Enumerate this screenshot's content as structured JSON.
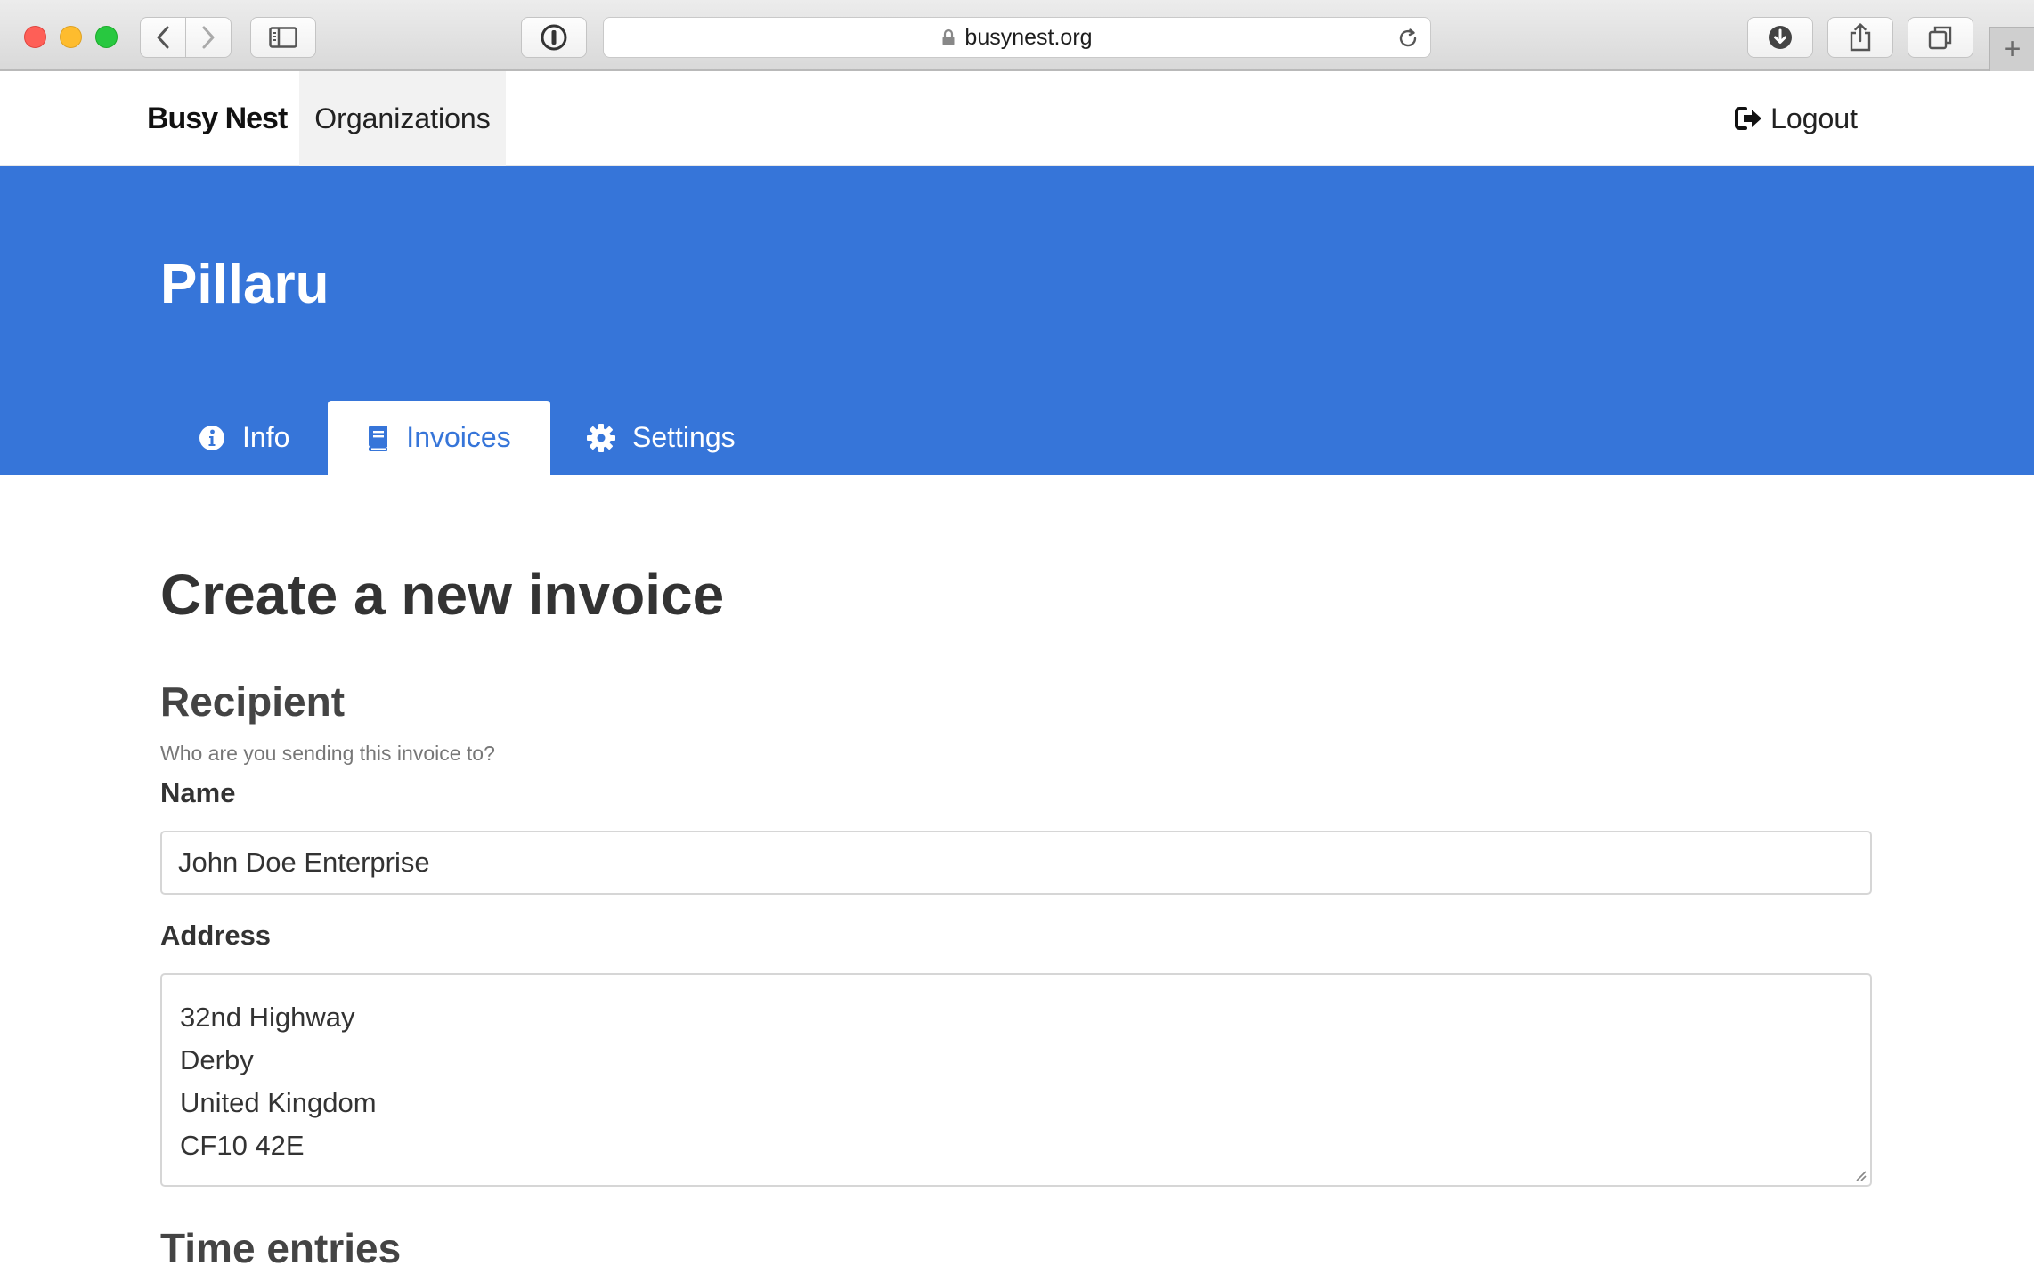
{
  "browser": {
    "url": "busynest.org"
  },
  "nav": {
    "brand": "Busy Nest",
    "organizations": "Organizations",
    "logout": "Logout"
  },
  "hero": {
    "org_name": "Pillaru",
    "tabs": [
      {
        "label": "Info",
        "icon": "info-icon",
        "active": false
      },
      {
        "label": "Invoices",
        "icon": "book-icon",
        "active": true
      },
      {
        "label": "Settings",
        "icon": "gear-icon",
        "active": false
      }
    ]
  },
  "form": {
    "title": "Create a new invoice",
    "recipient": {
      "heading": "Recipient",
      "hint": "Who are you sending this invoice to?",
      "name_label": "Name",
      "name_value": "John Doe Enterprise",
      "address_label": "Address",
      "address_lines": [
        "32nd Highway",
        "Derby",
        "United Kingdom",
        "CF10 42E"
      ]
    },
    "time_entries_heading": "Time entries"
  },
  "colors": {
    "primary": "#3675d9",
    "hero_text": "#ffffff",
    "text": "#333333"
  }
}
